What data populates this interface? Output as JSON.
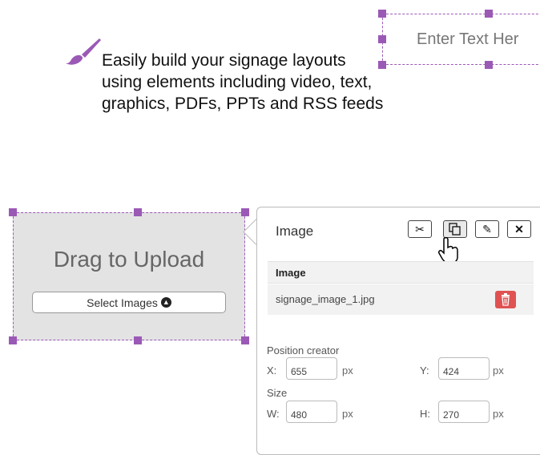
{
  "text_element": {
    "placeholder_text": "Enter Text Her"
  },
  "tagline": "Easily build your signage layouts using elements including video, text, graphics, PDFs, PPTs and RSS feeds",
  "upload": {
    "title": "Drag to Upload",
    "select_label": "Select Images",
    "select_icon": "upload-circle-icon"
  },
  "panel": {
    "title": "Image",
    "toolbar": [
      "scissors-icon",
      "copy-icon",
      "pencil-icon",
      "close-icon"
    ],
    "image_header": "Image",
    "file_name": "signage_image_1.jpg",
    "delete_icon": "trash-icon",
    "position_label": "Position creator",
    "x_label": "X:",
    "x_value": "655",
    "x_unit": "px",
    "y_label": "Y:",
    "y_value": "424",
    "y_unit": "px",
    "size_label": "Size",
    "w_label": "W:",
    "w_value": "480",
    "w_unit": "px",
    "h_label": "H:",
    "h_value": "270",
    "h_unit": "px"
  },
  "colors": {
    "accent": "#9b59b6",
    "delete": "#e05252",
    "upload_bg": "#e3e3e3"
  }
}
